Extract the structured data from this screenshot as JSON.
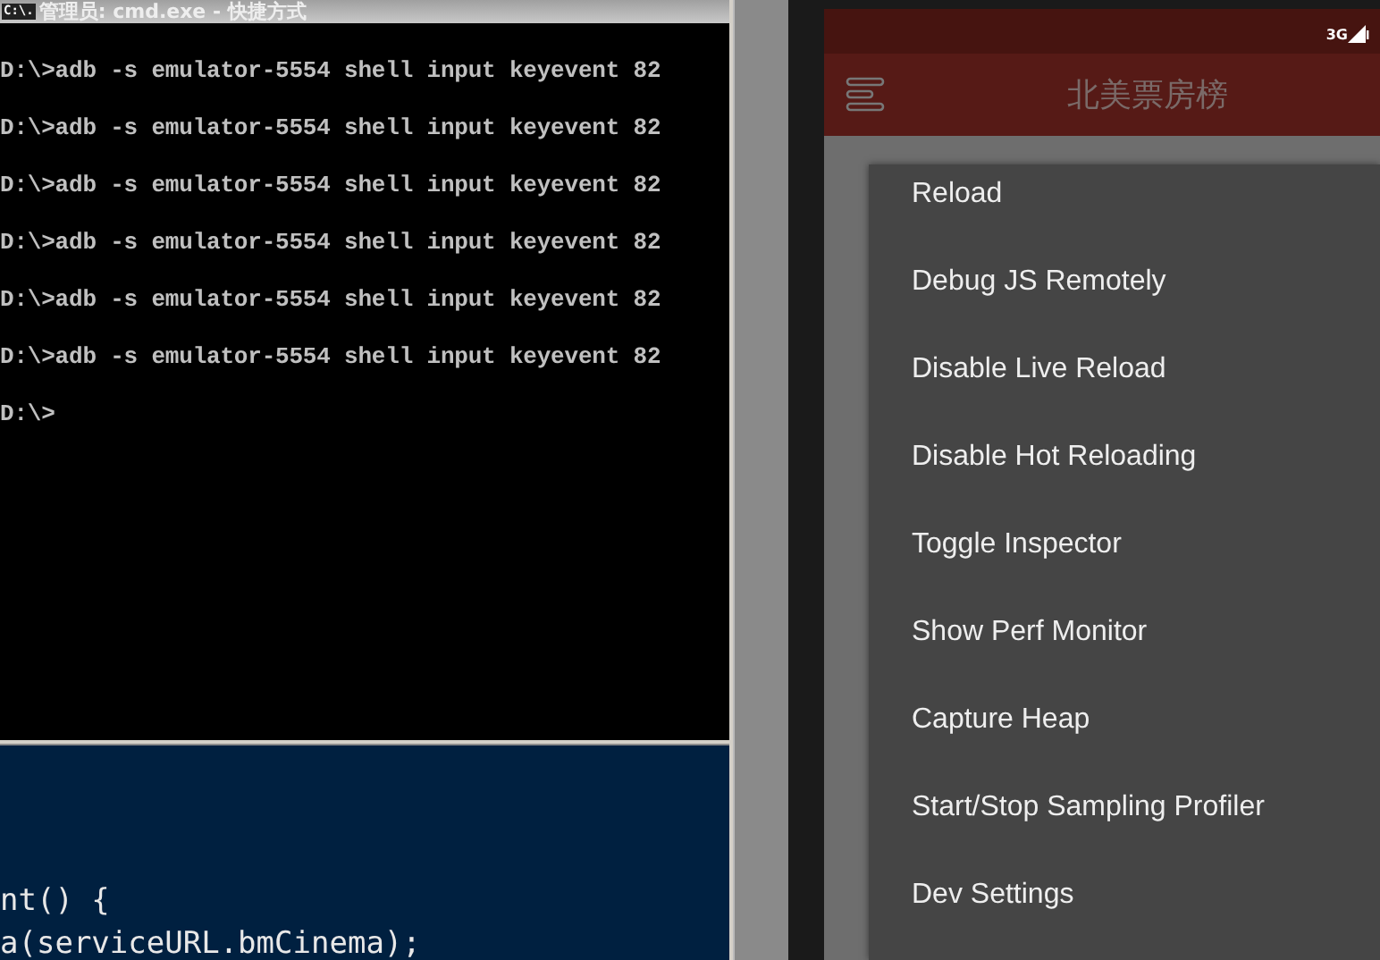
{
  "console_window": {
    "title": "管理员: cmd.exe - 快捷方式",
    "icon_text": "C:\\.",
    "lines": [
      "D:\\>adb -s emulator-5554 shell input keyevent 82",
      "D:\\>adb -s emulator-5554 shell input keyevent 82",
      "D:\\>adb -s emulator-5554 shell input keyevent 82",
      "D:\\>adb -s emulator-5554 shell input keyevent 82",
      "D:\\>adb -s emulator-5554 shell input keyevent 82",
      "D:\\>adb -s emulator-5554 shell input keyevent 82",
      "D:\\>"
    ]
  },
  "code_editor": {
    "lines": [
      {
        "kind": "blank"
      },
      {
        "kind": "blank"
      },
      {
        "kind": "blank"
      },
      {
        "kind": "plain",
        "text": "nt() {"
      },
      {
        "kind": "plain",
        "text": "a(serviceURL.bmCinema);"
      }
    ]
  },
  "phone": {
    "status_bar": {
      "network": "3G"
    },
    "app_bar": {
      "title": "北美票房榜"
    },
    "dev_menu": {
      "items": [
        "Reload",
        "Debug JS Remotely",
        "Disable Live Reload",
        "Disable Hot Reloading",
        "Toggle Inspector",
        "Show Perf Monitor",
        "Capture Heap",
        "Start/Stop Sampling Profiler",
        "Dev Settings"
      ]
    }
  }
}
